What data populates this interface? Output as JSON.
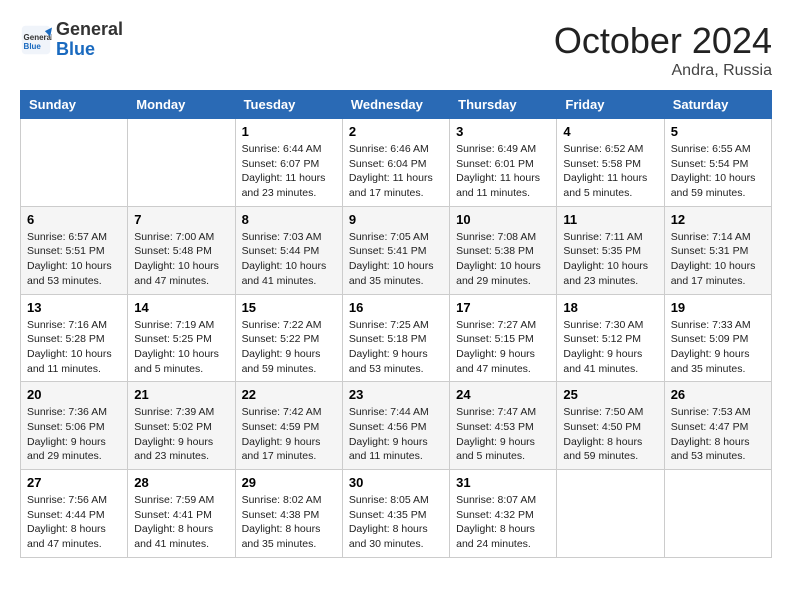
{
  "header": {
    "logo_general": "General",
    "logo_blue": "Blue",
    "month_title": "October 2024",
    "location": "Andra, Russia"
  },
  "days_of_week": [
    "Sunday",
    "Monday",
    "Tuesday",
    "Wednesday",
    "Thursday",
    "Friday",
    "Saturday"
  ],
  "weeks": [
    [
      {
        "day": "",
        "info": ""
      },
      {
        "day": "",
        "info": ""
      },
      {
        "day": "1",
        "info": "Sunrise: 6:44 AM\nSunset: 6:07 PM\nDaylight: 11 hours\nand 23 minutes."
      },
      {
        "day": "2",
        "info": "Sunrise: 6:46 AM\nSunset: 6:04 PM\nDaylight: 11 hours\nand 17 minutes."
      },
      {
        "day": "3",
        "info": "Sunrise: 6:49 AM\nSunset: 6:01 PM\nDaylight: 11 hours\nand 11 minutes."
      },
      {
        "day": "4",
        "info": "Sunrise: 6:52 AM\nSunset: 5:58 PM\nDaylight: 11 hours\nand 5 minutes."
      },
      {
        "day": "5",
        "info": "Sunrise: 6:55 AM\nSunset: 5:54 PM\nDaylight: 10 hours\nand 59 minutes."
      }
    ],
    [
      {
        "day": "6",
        "info": "Sunrise: 6:57 AM\nSunset: 5:51 PM\nDaylight: 10 hours\nand 53 minutes."
      },
      {
        "day": "7",
        "info": "Sunrise: 7:00 AM\nSunset: 5:48 PM\nDaylight: 10 hours\nand 47 minutes."
      },
      {
        "day": "8",
        "info": "Sunrise: 7:03 AM\nSunset: 5:44 PM\nDaylight: 10 hours\nand 41 minutes."
      },
      {
        "day": "9",
        "info": "Sunrise: 7:05 AM\nSunset: 5:41 PM\nDaylight: 10 hours\nand 35 minutes."
      },
      {
        "day": "10",
        "info": "Sunrise: 7:08 AM\nSunset: 5:38 PM\nDaylight: 10 hours\nand 29 minutes."
      },
      {
        "day": "11",
        "info": "Sunrise: 7:11 AM\nSunset: 5:35 PM\nDaylight: 10 hours\nand 23 minutes."
      },
      {
        "day": "12",
        "info": "Sunrise: 7:14 AM\nSunset: 5:31 PM\nDaylight: 10 hours\nand 17 minutes."
      }
    ],
    [
      {
        "day": "13",
        "info": "Sunrise: 7:16 AM\nSunset: 5:28 PM\nDaylight: 10 hours\nand 11 minutes."
      },
      {
        "day": "14",
        "info": "Sunrise: 7:19 AM\nSunset: 5:25 PM\nDaylight: 10 hours\nand 5 minutes."
      },
      {
        "day": "15",
        "info": "Sunrise: 7:22 AM\nSunset: 5:22 PM\nDaylight: 9 hours\nand 59 minutes."
      },
      {
        "day": "16",
        "info": "Sunrise: 7:25 AM\nSunset: 5:18 PM\nDaylight: 9 hours\nand 53 minutes."
      },
      {
        "day": "17",
        "info": "Sunrise: 7:27 AM\nSunset: 5:15 PM\nDaylight: 9 hours\nand 47 minutes."
      },
      {
        "day": "18",
        "info": "Sunrise: 7:30 AM\nSunset: 5:12 PM\nDaylight: 9 hours\nand 41 minutes."
      },
      {
        "day": "19",
        "info": "Sunrise: 7:33 AM\nSunset: 5:09 PM\nDaylight: 9 hours\nand 35 minutes."
      }
    ],
    [
      {
        "day": "20",
        "info": "Sunrise: 7:36 AM\nSunset: 5:06 PM\nDaylight: 9 hours\nand 29 minutes."
      },
      {
        "day": "21",
        "info": "Sunrise: 7:39 AM\nSunset: 5:02 PM\nDaylight: 9 hours\nand 23 minutes."
      },
      {
        "day": "22",
        "info": "Sunrise: 7:42 AM\nSunset: 4:59 PM\nDaylight: 9 hours\nand 17 minutes."
      },
      {
        "day": "23",
        "info": "Sunrise: 7:44 AM\nSunset: 4:56 PM\nDaylight: 9 hours\nand 11 minutes."
      },
      {
        "day": "24",
        "info": "Sunrise: 7:47 AM\nSunset: 4:53 PM\nDaylight: 9 hours\nand 5 minutes."
      },
      {
        "day": "25",
        "info": "Sunrise: 7:50 AM\nSunset: 4:50 PM\nDaylight: 8 hours\nand 59 minutes."
      },
      {
        "day": "26",
        "info": "Sunrise: 7:53 AM\nSunset: 4:47 PM\nDaylight: 8 hours\nand 53 minutes."
      }
    ],
    [
      {
        "day": "27",
        "info": "Sunrise: 7:56 AM\nSunset: 4:44 PM\nDaylight: 8 hours\nand 47 minutes."
      },
      {
        "day": "28",
        "info": "Sunrise: 7:59 AM\nSunset: 4:41 PM\nDaylight: 8 hours\nand 41 minutes."
      },
      {
        "day": "29",
        "info": "Sunrise: 8:02 AM\nSunset: 4:38 PM\nDaylight: 8 hours\nand 35 minutes."
      },
      {
        "day": "30",
        "info": "Sunrise: 8:05 AM\nSunset: 4:35 PM\nDaylight: 8 hours\nand 30 minutes."
      },
      {
        "day": "31",
        "info": "Sunrise: 8:07 AM\nSunset: 4:32 PM\nDaylight: 8 hours\nand 24 minutes."
      },
      {
        "day": "",
        "info": ""
      },
      {
        "day": "",
        "info": ""
      }
    ]
  ]
}
